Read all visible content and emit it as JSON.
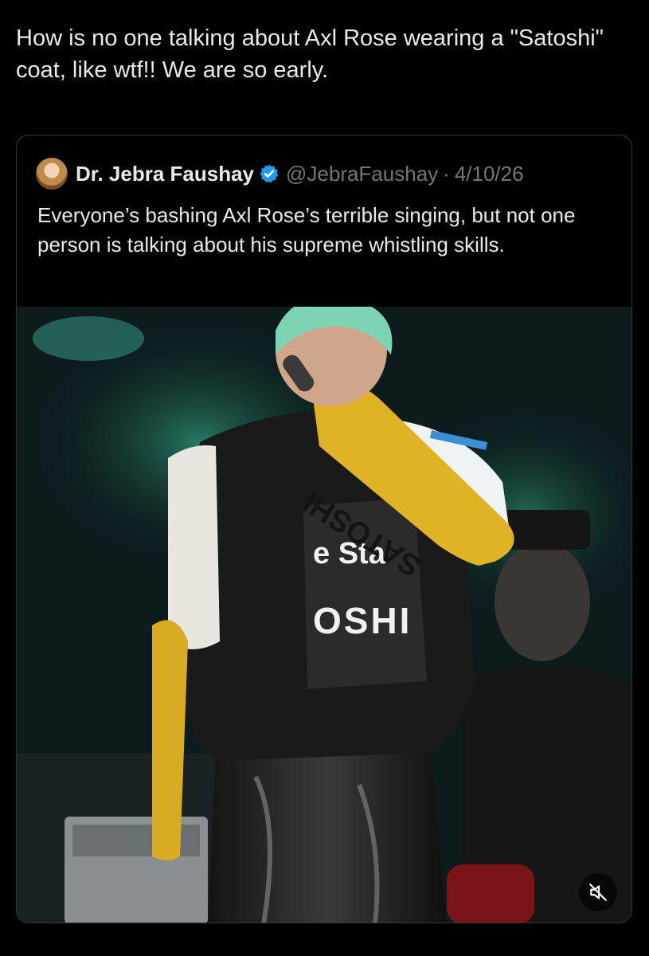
{
  "post": {
    "text": "How is no one talking about Axl Rose wearing a \"Satoshi\" coat, like wtf!! We are so early."
  },
  "quoted_post": {
    "display_name": "Dr. Jebra Faushay",
    "handle": "@JebraFaushay",
    "separator": "·",
    "date": "4/10/26",
    "text": "Everyone’s bashing Axl Rose’s terrible singing, but not one person is talking about his supreme whistling skills.",
    "verified_icon": "verified-badge-icon",
    "verified_color": "#1d9bf0"
  },
  "media": {
    "sleeve_text": "SATOSHI",
    "shirt_line1": "e Sta",
    "shirt_line2": "OSHI",
    "mute_icon": "speaker-muted-icon"
  }
}
